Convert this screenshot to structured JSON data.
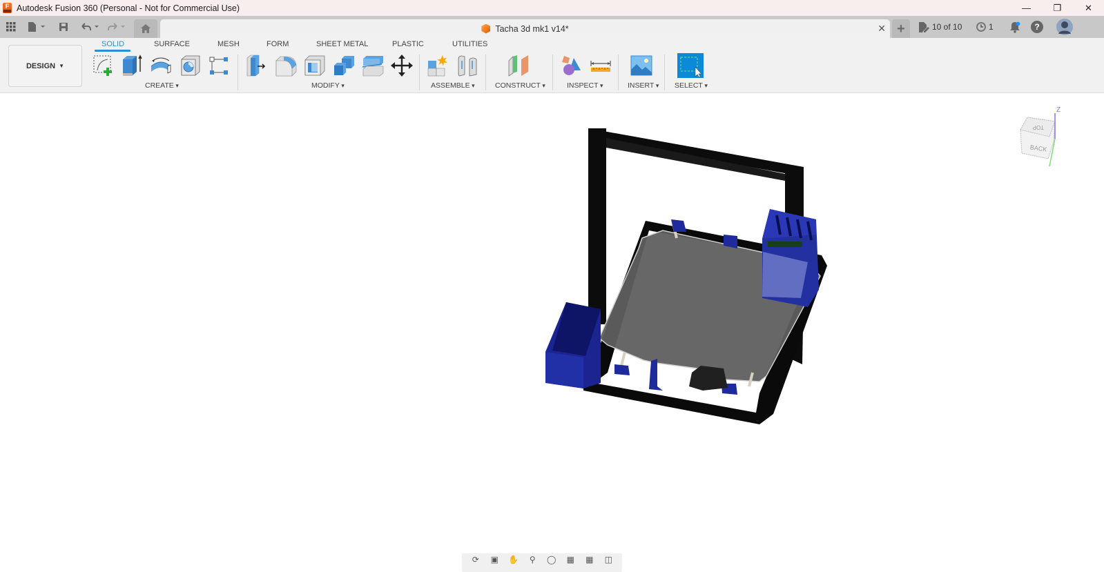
{
  "window": {
    "title": "Autodesk Fusion 360 (Personal - Not for Commercial Use)",
    "app_icon": "fusion-360-logo",
    "controls": [
      "minimize",
      "restore",
      "close"
    ]
  },
  "appbar": {
    "icons": [
      "apps-grid-icon",
      "file-menu-icon",
      "save-icon",
      "undo-icon",
      "redo-icon"
    ],
    "home_tab_icon": "home-icon",
    "document_tab": {
      "title": "Tacha 3d mk1 v14*",
      "icon": "component-cube-icon"
    },
    "new_tab_label": "+",
    "version_counter": "10 of 10",
    "job_status_count": "1",
    "notifications_icon": "bell-icon",
    "help_label": "?",
    "avatar_icon": "user-avatar"
  },
  "toolbar": {
    "workspace": "DESIGN",
    "tabs": [
      {
        "label": "SOLID",
        "active": true
      },
      {
        "label": "SURFACE",
        "active": false
      },
      {
        "label": "MESH",
        "active": false
      },
      {
        "label": "FORM",
        "active": false
      },
      {
        "label": "SHEET METAL",
        "active": false
      },
      {
        "label": "PLASTIC",
        "active": false
      },
      {
        "label": "UTILITIES",
        "active": false
      }
    ],
    "groups": [
      {
        "label": "CREATE",
        "tools": [
          "create-sketch",
          "extrude",
          "revolve",
          "hole",
          "pattern"
        ]
      },
      {
        "label": "MODIFY",
        "tools": [
          "press-pull",
          "fillet",
          "shell",
          "combine",
          "split-body",
          "move-copy"
        ]
      },
      {
        "label": "ASSEMBLE",
        "tools": [
          "new-component",
          "joint"
        ]
      },
      {
        "label": "CONSTRUCT",
        "tools": [
          "offset-plane"
        ]
      },
      {
        "label": "INSPECT",
        "tools": [
          "interference",
          "measure"
        ]
      },
      {
        "label": "INSERT",
        "tools": [
          "insert-image"
        ]
      },
      {
        "label": "SELECT",
        "tools": [
          "window-select"
        ]
      }
    ]
  },
  "viewport": {
    "model_description": "3D printer frame assembly",
    "viewcube": {
      "faces": [
        "TOP",
        "BACK"
      ],
      "axes": [
        "Z",
        "Y"
      ]
    },
    "nav_tools": [
      "orbit",
      "look-at",
      "pan",
      "zoom",
      "fit",
      "display-settings",
      "grid",
      "viewports"
    ]
  },
  "colors": {
    "accent": "#2a8fd0",
    "select_blue": "#0b8ad7",
    "frame_black": "#0c0c0c",
    "part_blue": "#1f2a9c",
    "bed_gray": "#606060"
  }
}
